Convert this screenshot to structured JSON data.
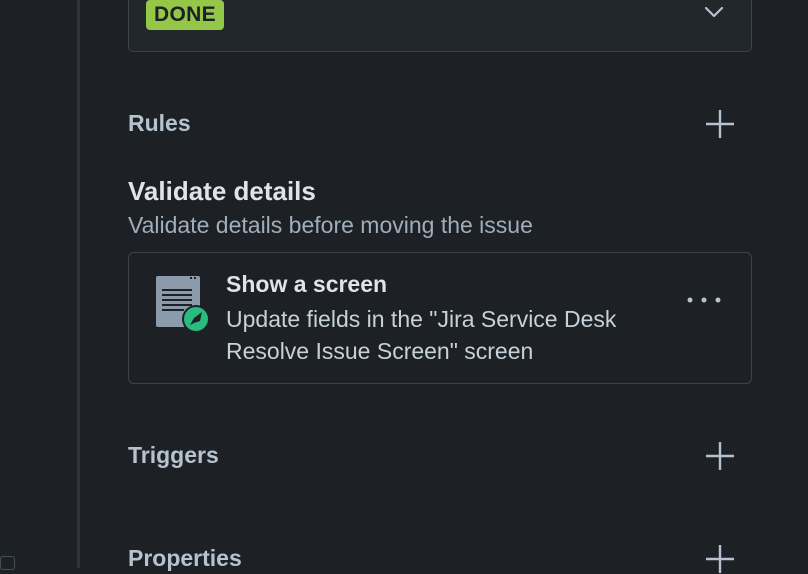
{
  "status": {
    "label": "DONE",
    "lozenge_color": "#94c748"
  },
  "sections": {
    "rules": "Rules",
    "triggers": "Triggers",
    "properties": "Properties"
  },
  "validate": {
    "title": "Validate details",
    "subtitle": "Validate details before moving the issue"
  },
  "rule_card": {
    "title": "Show a screen",
    "description": "Update fields in the \"Jira Service Desk Resolve Issue Screen\" screen",
    "icon": "screen-document-icon"
  },
  "icons": {
    "add": "plus-icon",
    "more": "more-horizontal-icon",
    "dropdown": "chevron-down-icon"
  }
}
